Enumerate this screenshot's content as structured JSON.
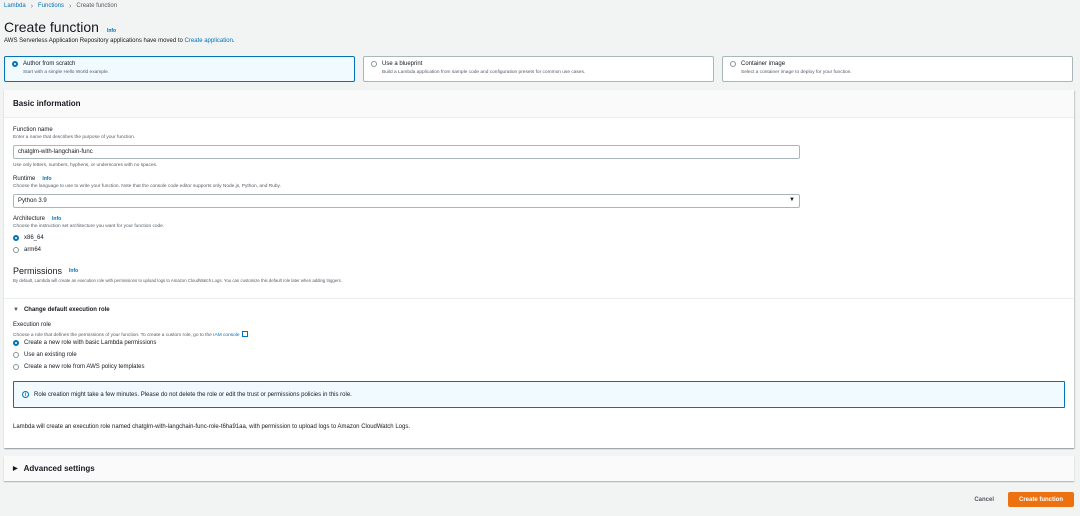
{
  "breadcrumb": {
    "items": [
      "Lambda",
      "Functions"
    ],
    "current": "Create function"
  },
  "header": {
    "title": "Create function",
    "info": "Info"
  },
  "subtitle": {
    "text": "AWS Serverless Application Repository applications have moved to ",
    "link": "Create application",
    "suffix": "."
  },
  "options": [
    {
      "title": "Author from scratch",
      "desc": "Start with a simple Hello World example.",
      "selected": true
    },
    {
      "title": "Use a blueprint",
      "desc": "Build a Lambda application from sample code and configuration presets for common use cases.",
      "selected": false
    },
    {
      "title": "Container image",
      "desc": "Select a container image to deploy for your function.",
      "selected": false
    }
  ],
  "basic": {
    "title": "Basic information",
    "function_name": {
      "label": "Function name",
      "desc": "Enter a name that describes the purpose of your function.",
      "value": "chatglm-with-langchain-func",
      "hint": "Use only letters, numbers, hyphens, or underscores with no spaces."
    },
    "runtime": {
      "label": "Runtime",
      "info": "Info",
      "desc": "Choose the language to use to write your function. Note that the console code editor supports only Node.js, Python, and Ruby.",
      "value": "Python 3.9"
    },
    "architecture": {
      "label": "Architecture",
      "info": "Info",
      "desc": "Choose the instruction set architecture you want for your function code.",
      "options": [
        "x86_64",
        "arm64"
      ]
    },
    "permissions": {
      "title": "Permissions",
      "info": "Info",
      "desc": "By default, Lambda will create an execution role with permissions to upload logs to Amazon CloudWatch Logs. You can customize this default role later when adding triggers."
    },
    "exec_role": {
      "expander": "Change default execution role",
      "label": "Execution role",
      "desc": "Choose a role that defines the permissions of your function. To create a custom role, go to the ",
      "desc_link": "IAM console",
      "options": [
        "Create a new role with basic Lambda permissions",
        "Use an existing role",
        "Create a new role from AWS policy templates"
      ]
    },
    "alert": "Role creation might take a few minutes. Please do not delete the role or edit the trust or permissions policies in this role.",
    "note": "Lambda will create an execution role named chatglm-with-langchain-func-role-t6ha91aa, with permission to upload logs to Amazon CloudWatch Logs."
  },
  "advanced": {
    "title": "Advanced settings"
  },
  "actions": {
    "cancel": "Cancel",
    "create": "Create function"
  }
}
